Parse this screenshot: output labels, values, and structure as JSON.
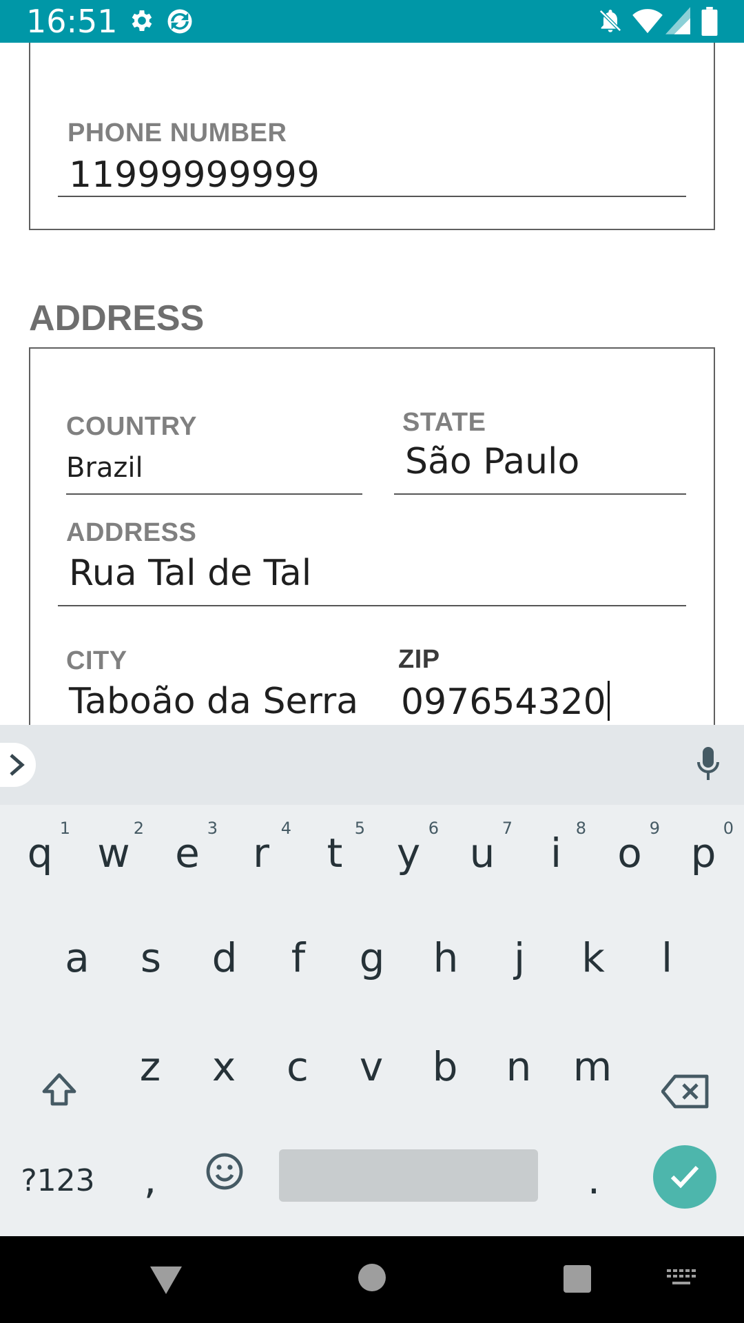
{
  "status_bar": {
    "time": "16:51",
    "left_icons": [
      "gear-icon",
      "sync-icon"
    ],
    "right_icons": [
      "notifications-off-icon",
      "wifi-icon",
      "signal-icon",
      "battery-icon"
    ],
    "background": "#0097a7"
  },
  "contact": {
    "phone_label": "PHONE NUMBER",
    "phone_value": "11999999999"
  },
  "address_section": {
    "title": "ADDRESS",
    "country_label": "COUNTRY",
    "country_value": "Brazil",
    "state_label": "STATE",
    "state_value": "São Paulo",
    "address_label": "ADDRESS",
    "address_value": "Rua Tal de Tal",
    "city_label": "CITY",
    "city_value": "Taboão da Serra",
    "zip_label": "ZIP",
    "zip_value": "097654320"
  },
  "keyboard": {
    "row1": [
      {
        "key": "q",
        "hint": "1"
      },
      {
        "key": "w",
        "hint": "2"
      },
      {
        "key": "e",
        "hint": "3"
      },
      {
        "key": "r",
        "hint": "4"
      },
      {
        "key": "t",
        "hint": "5"
      },
      {
        "key": "y",
        "hint": "6"
      },
      {
        "key": "u",
        "hint": "7"
      },
      {
        "key": "i",
        "hint": "8"
      },
      {
        "key": "o",
        "hint": "9"
      },
      {
        "key": "p",
        "hint": "0"
      }
    ],
    "row2": [
      "a",
      "s",
      "d",
      "f",
      "g",
      "h",
      "j",
      "k",
      "l"
    ],
    "row3": [
      "z",
      "x",
      "c",
      "v",
      "b",
      "n",
      "m"
    ],
    "symbols_key": "?123",
    "comma_key": ",",
    "period_key": ".",
    "accent": "#4db6ac"
  }
}
